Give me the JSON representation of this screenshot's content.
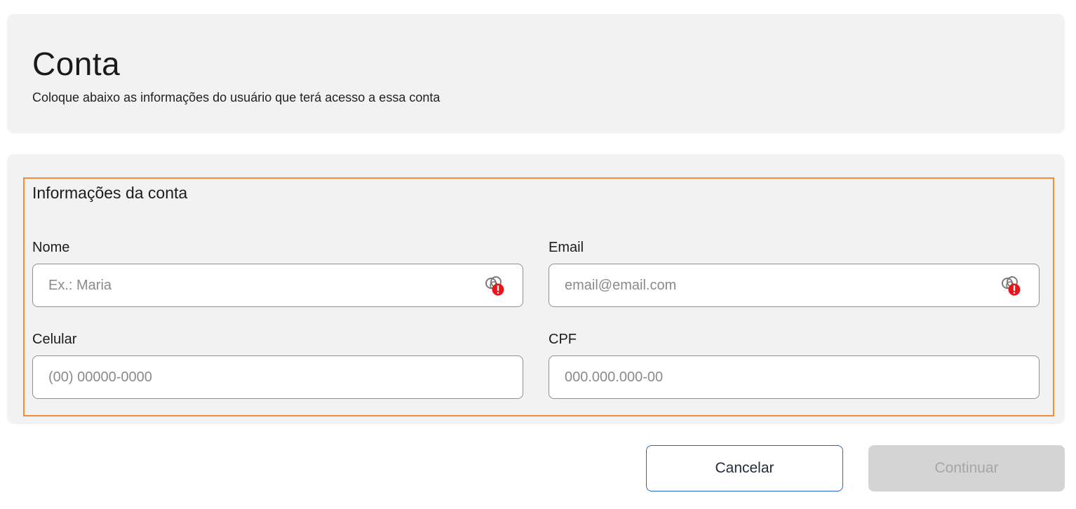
{
  "header": {
    "title": "Conta",
    "subtitle": "Coloque abaixo as informações do usuário que terá acesso a essa conta"
  },
  "form": {
    "section_title": "Informações da conta",
    "fields": {
      "nome": {
        "label": "Nome",
        "placeholder": "Ex.: Maria",
        "value": "",
        "icon": "password-manager-warning-icon"
      },
      "email": {
        "label": "Email",
        "placeholder": "email@email.com",
        "value": "",
        "icon": "password-manager-warning-icon"
      },
      "celular": {
        "label": "Celular",
        "placeholder": "(00) 00000-0000",
        "value": ""
      },
      "cpf": {
        "label": "CPF",
        "placeholder": "000.000.000-00",
        "value": ""
      }
    }
  },
  "actions": {
    "cancel_label": "Cancelar",
    "continue_label": "Continuar",
    "continue_disabled": true
  },
  "colors": {
    "highlight_border": "#f28c38",
    "cancel_border": "#2a64c8",
    "warning_badge": "#e8161b",
    "card_background": "#f2f2f2",
    "disabled_button": "#d4d4d4"
  }
}
